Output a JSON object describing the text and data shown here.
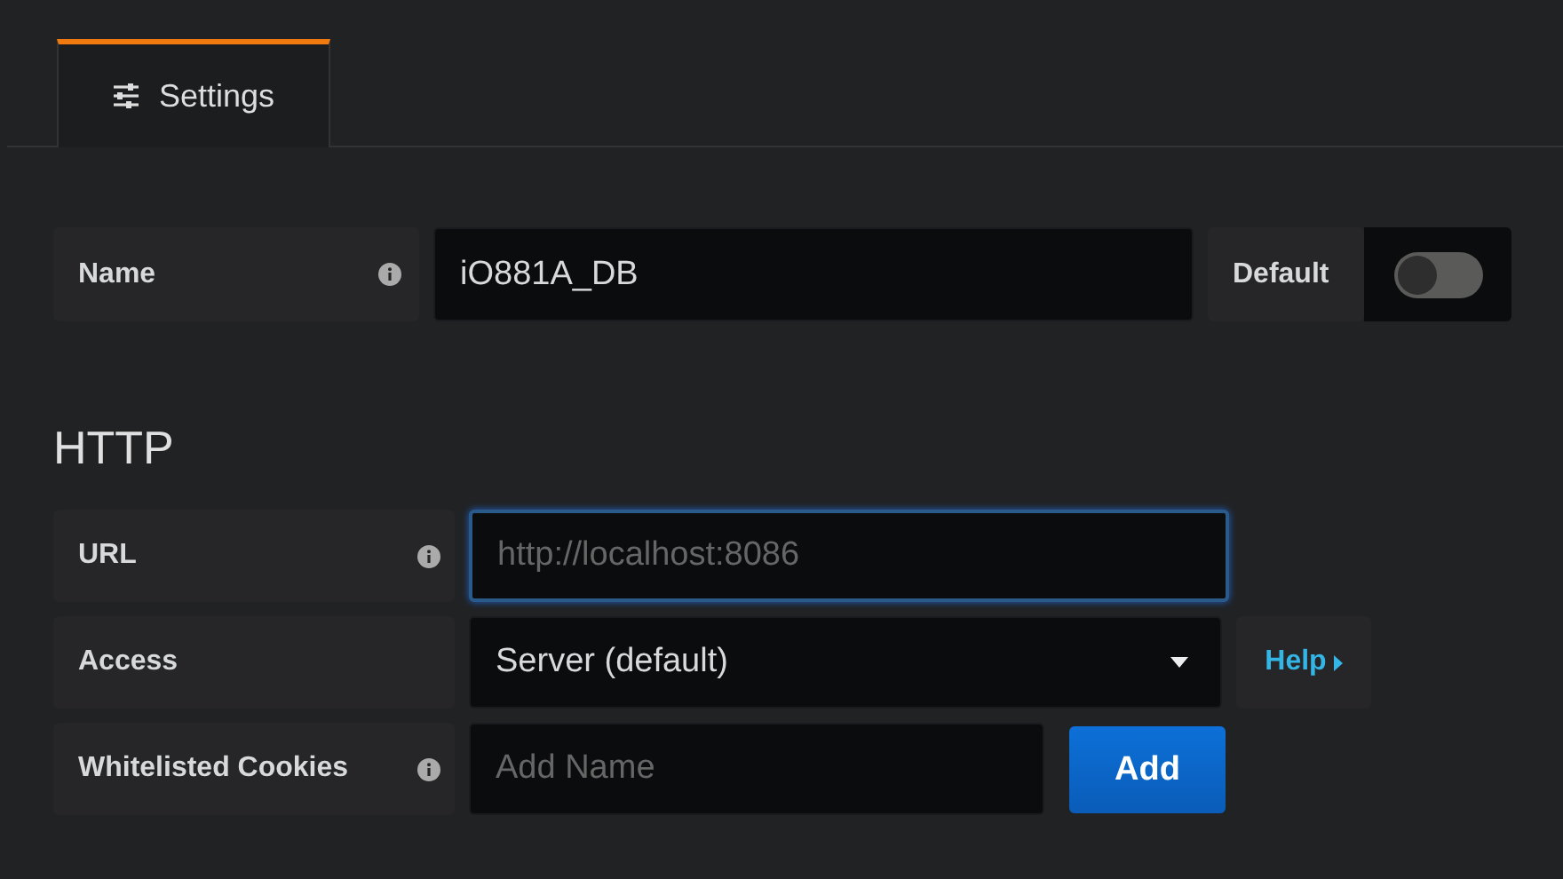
{
  "tabs": [
    {
      "label": "Settings",
      "selected": true
    }
  ],
  "name_row": {
    "label": "Name",
    "info": true,
    "value": "iO881A_DB",
    "default_label": "Default",
    "default_on": false
  },
  "section_title": "HTTP",
  "http_rows": [
    {
      "kind": "input",
      "label": "URL",
      "info": true,
      "placeholder": "http://localhost:8086",
      "focused": true
    },
    {
      "kind": "select",
      "label": "Access",
      "info": false,
      "value": "Server (default)",
      "help": "Help"
    },
    {
      "kind": "cookies",
      "label": "Whitelisted Cookies",
      "info": true,
      "placeholder": "Add Name",
      "button": "Add"
    }
  ]
}
